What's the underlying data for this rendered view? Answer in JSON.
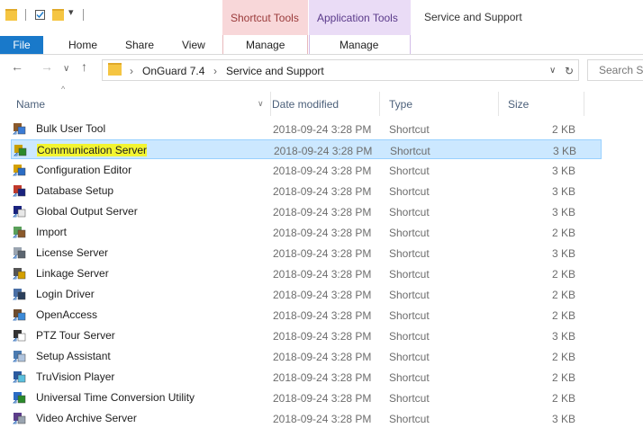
{
  "ribbon": {
    "context_tab_1": "Shortcut Tools",
    "context_tab_2": "Application Tools",
    "window_title": "Service and Support",
    "tabs": [
      "File",
      "Home",
      "Share",
      "View",
      "Manage",
      "Manage"
    ],
    "colors": {
      "file_tab": "#1979ca",
      "shortcut_tools": "#f8d7d9",
      "application_tools": "#eadcf6"
    }
  },
  "address": {
    "crumbs": [
      "OnGuard 7.4",
      "Service and Support"
    ],
    "search_placeholder": "Search S"
  },
  "columns": {
    "name": "Name",
    "date": "Date modified",
    "type": "Type",
    "size": "Size"
  },
  "files": [
    {
      "name": "Bulk User Tool",
      "date": "2018-09-24 3:28 PM",
      "type": "Shortcut",
      "size": "2 KB",
      "icon": "users-app-icon"
    },
    {
      "name": "Communication Server",
      "date": "2018-09-24 3:28 PM",
      "type": "Shortcut",
      "size": "3 KB",
      "icon": "communication-server-icon",
      "selected": true
    },
    {
      "name": "Configuration Editor",
      "date": "2018-09-24 3:28 PM",
      "type": "Shortcut",
      "size": "3 KB",
      "icon": "config-editor-icon"
    },
    {
      "name": "Database Setup",
      "date": "2018-09-24 3:28 PM",
      "type": "Shortcut",
      "size": "3 KB",
      "icon": "database-icon"
    },
    {
      "name": "Global Output Server",
      "date": "2018-09-24 3:28 PM",
      "type": "Shortcut",
      "size": "3 KB",
      "icon": "global-output-icon"
    },
    {
      "name": "Import",
      "date": "2018-09-24 3:28 PM",
      "type": "Shortcut",
      "size": "2 KB",
      "icon": "import-icon"
    },
    {
      "name": "License Server",
      "date": "2018-09-24 3:28 PM",
      "type": "Shortcut",
      "size": "3 KB",
      "icon": "license-icon"
    },
    {
      "name": "Linkage Server",
      "date": "2018-09-24 3:28 PM",
      "type": "Shortcut",
      "size": "2 KB",
      "icon": "linkage-icon"
    },
    {
      "name": "Login Driver",
      "date": "2018-09-24 3:28 PM",
      "type": "Shortcut",
      "size": "2 KB",
      "icon": "login-driver-icon"
    },
    {
      "name": "OpenAccess",
      "date": "2018-09-24 3:28 PM",
      "type": "Shortcut",
      "size": "2 KB",
      "icon": "openaccess-icon"
    },
    {
      "name": "PTZ Tour Server",
      "date": "2018-09-24 3:28 PM",
      "type": "Shortcut",
      "size": "3 KB",
      "icon": "ptz-icon"
    },
    {
      "name": "Setup Assistant",
      "date": "2018-09-24 3:28 PM",
      "type": "Shortcut",
      "size": "2 KB",
      "icon": "setup-icon"
    },
    {
      "name": "TruVision Player",
      "date": "2018-09-24 3:28 PM",
      "type": "Shortcut",
      "size": "2 KB",
      "icon": "truvision-icon"
    },
    {
      "name": "Universal Time Conversion Utility",
      "date": "2018-09-24 3:28 PM",
      "type": "Shortcut",
      "size": "2 KB",
      "icon": "time-conversion-icon"
    },
    {
      "name": "Video Archive Server",
      "date": "2018-09-24 3:28 PM",
      "type": "Shortcut",
      "size": "3 KB",
      "icon": "video-archive-icon"
    }
  ]
}
